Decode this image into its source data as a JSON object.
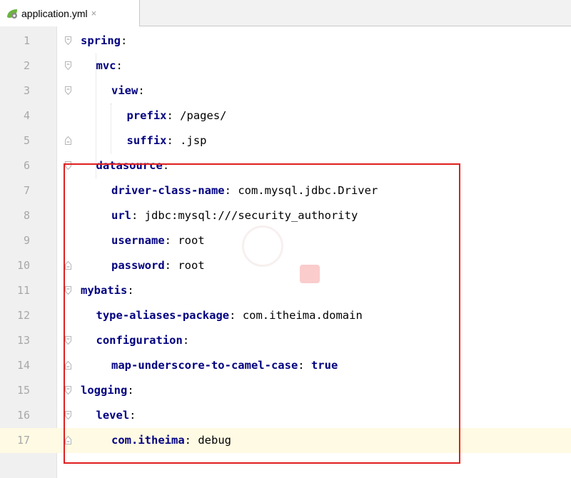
{
  "tab": {
    "filename": "application.yml",
    "close": "×"
  },
  "icons": {
    "tab_icon": "spring-leaf-yaml-icon",
    "fold": "fold-marker-icon"
  },
  "colors": {
    "key": "#000080",
    "highlight_box": "#e01f1f",
    "current_line": "#fffae3"
  },
  "lines": [
    {
      "num": "1",
      "key": "spring",
      "sep": ":",
      "value": ""
    },
    {
      "num": "2",
      "key": "mvc",
      "sep": ":",
      "value": ""
    },
    {
      "num": "3",
      "key": "view",
      "sep": ":",
      "value": ""
    },
    {
      "num": "4",
      "key": "prefix",
      "sep": ":",
      "value": " /pages/"
    },
    {
      "num": "5",
      "key": "suffix",
      "sep": ":",
      "value": " .jsp"
    },
    {
      "num": "6",
      "key": "datasource",
      "sep": ":",
      "value": ""
    },
    {
      "num": "7",
      "key": "driver-class-name",
      "sep": ":",
      "value": " com.mysql.jdbc.Driver"
    },
    {
      "num": "8",
      "key": "url",
      "sep": ":",
      "value": " jdbc:mysql:///security_authority"
    },
    {
      "num": "9",
      "key": "username",
      "sep": ":",
      "value": " root"
    },
    {
      "num": "10",
      "key": "password",
      "sep": ":",
      "value": " root"
    },
    {
      "num": "11",
      "key": "mybatis",
      "sep": ":",
      "value": ""
    },
    {
      "num": "12",
      "key": "type-aliases-package",
      "sep": ":",
      "value": " com.itheima.domain"
    },
    {
      "num": "13",
      "key": "configuration",
      "sep": ":",
      "value": ""
    },
    {
      "num": "14",
      "key": "map-underscore-to-camel-case",
      "sep": ":",
      "value": "",
      "bool": " true"
    },
    {
      "num": "15",
      "key": "logging",
      "sep": ":",
      "value": ""
    },
    {
      "num": "16",
      "key": "level",
      "sep": ":",
      "value": ""
    },
    {
      "num": "17",
      "key": "com.itheima",
      "sep": ":",
      "value": " debug"
    }
  ]
}
